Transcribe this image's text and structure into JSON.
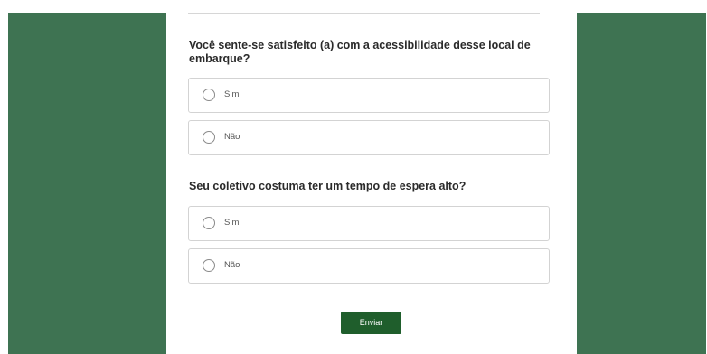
{
  "survey": {
    "questions": [
      {
        "text": "Você sente-se satisfeito (a) com a acessibilidade desse local de embarque?",
        "options": [
          {
            "label": "Sim"
          },
          {
            "label": "Não"
          }
        ]
      },
      {
        "text": "Seu coletivo costuma ter um tempo de espera alto?",
        "options": [
          {
            "label": "Sim"
          },
          {
            "label": "Não"
          }
        ]
      }
    ],
    "submit_label": "Enviar"
  },
  "colors": {
    "page_background": "#3e7352",
    "button_background": "#1f5e2c"
  },
  "icons": {
    "radio": "radio-unchecked-icon"
  }
}
